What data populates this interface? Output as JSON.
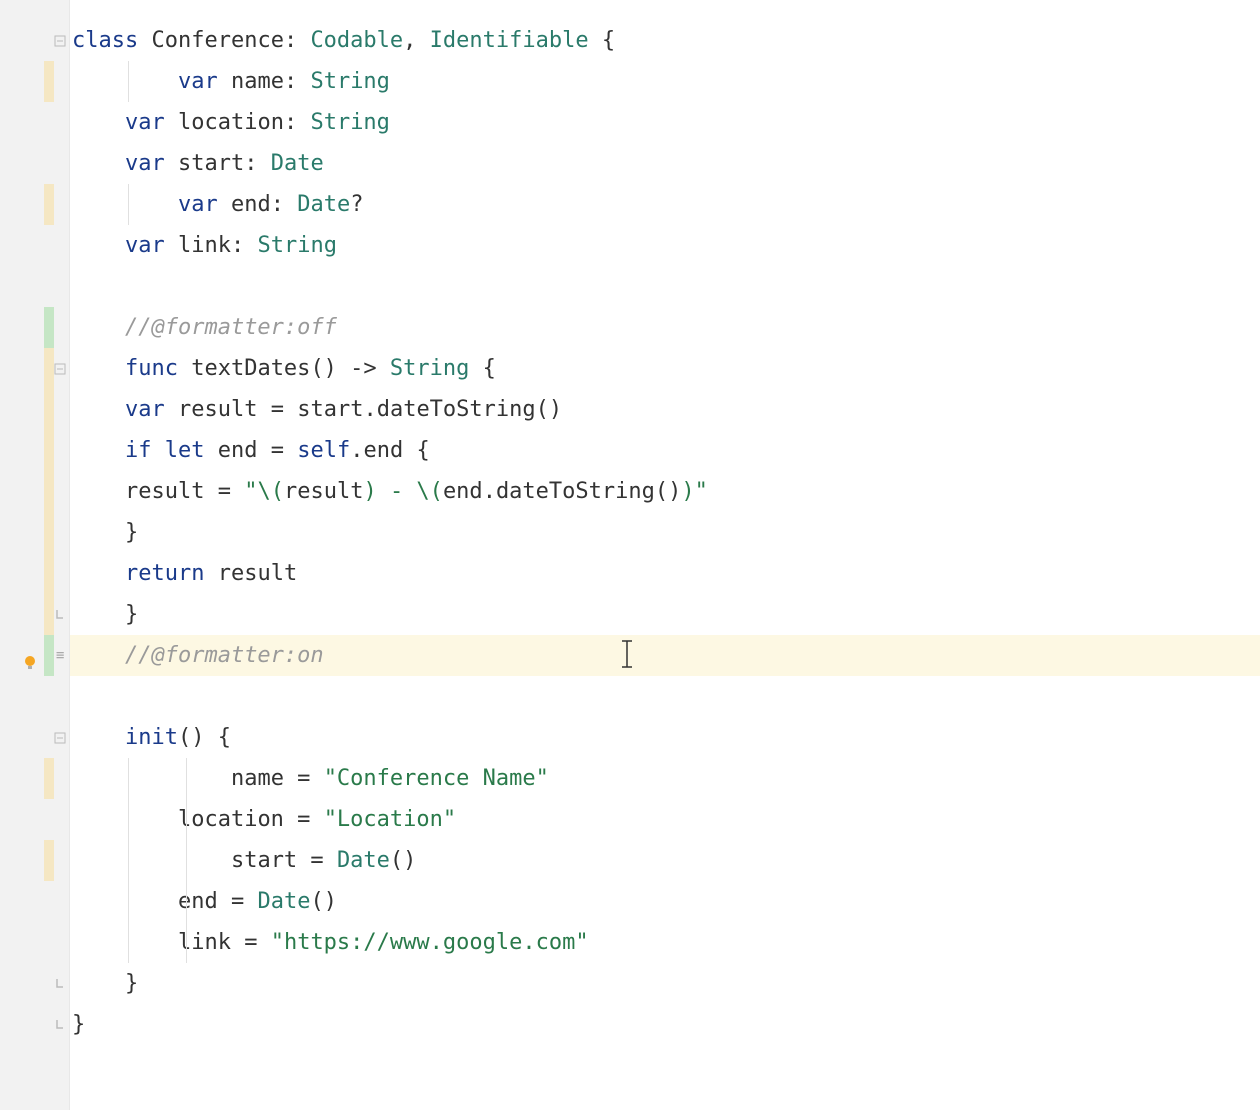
{
  "code": {
    "lines": [
      {
        "indent": 0,
        "tokens": [
          {
            "t": "kw",
            "v": "class"
          },
          {
            "t": "punct",
            "v": " "
          },
          {
            "t": "ident",
            "v": "Conference"
          },
          {
            "t": "punct",
            "v": ": "
          },
          {
            "t": "type",
            "v": "Codable"
          },
          {
            "t": "punct",
            "v": ", "
          },
          {
            "t": "type",
            "v": "Identifiable"
          },
          {
            "t": "punct",
            "v": " {"
          }
        ],
        "fold": "open",
        "marker": null
      },
      {
        "indent": 2,
        "tokens": [
          {
            "t": "kw",
            "v": "var"
          },
          {
            "t": "punct",
            "v": " "
          },
          {
            "t": "ident",
            "v": "name"
          },
          {
            "t": "punct",
            "v": ": "
          },
          {
            "t": "type",
            "v": "String"
          }
        ],
        "marker": "yellow",
        "guide": 1
      },
      {
        "indent": 1,
        "tokens": [
          {
            "t": "kw",
            "v": "var"
          },
          {
            "t": "punct",
            "v": " "
          },
          {
            "t": "ident",
            "v": "location"
          },
          {
            "t": "punct",
            "v": ": "
          },
          {
            "t": "type",
            "v": "String"
          }
        ],
        "marker": null
      },
      {
        "indent": 1,
        "tokens": [
          {
            "t": "kw",
            "v": "var"
          },
          {
            "t": "punct",
            "v": " "
          },
          {
            "t": "ident",
            "v": "start"
          },
          {
            "t": "punct",
            "v": ": "
          },
          {
            "t": "type",
            "v": "Date"
          }
        ],
        "marker": null
      },
      {
        "indent": 2,
        "tokens": [
          {
            "t": "kw",
            "v": "var"
          },
          {
            "t": "punct",
            "v": " "
          },
          {
            "t": "ident",
            "v": "end"
          },
          {
            "t": "punct",
            "v": ": "
          },
          {
            "t": "type",
            "v": "Date"
          },
          {
            "t": "punct",
            "v": "?"
          }
        ],
        "marker": "yellow",
        "guide": 1
      },
      {
        "indent": 1,
        "tokens": [
          {
            "t": "kw",
            "v": "var"
          },
          {
            "t": "punct",
            "v": " "
          },
          {
            "t": "ident",
            "v": "link"
          },
          {
            "t": "punct",
            "v": ": "
          },
          {
            "t": "type",
            "v": "String"
          }
        ],
        "marker": null
      },
      {
        "indent": 0,
        "tokens": [],
        "marker": null
      },
      {
        "indent": 1,
        "tokens": [
          {
            "t": "comment",
            "v": "//@formatter:off"
          }
        ],
        "marker": "green"
      },
      {
        "indent": 1,
        "tokens": [
          {
            "t": "kw",
            "v": "func"
          },
          {
            "t": "punct",
            "v": " "
          },
          {
            "t": "func",
            "v": "textDates"
          },
          {
            "t": "punct",
            "v": "() -> "
          },
          {
            "t": "type",
            "v": "String"
          },
          {
            "t": "punct",
            "v": " {"
          }
        ],
        "fold": "open",
        "marker": "yellow"
      },
      {
        "indent": 1,
        "tokens": [
          {
            "t": "kw",
            "v": "var"
          },
          {
            "t": "punct",
            "v": " "
          },
          {
            "t": "ident",
            "v": "result"
          },
          {
            "t": "punct",
            "v": " = "
          },
          {
            "t": "ident",
            "v": "start"
          },
          {
            "t": "punct",
            "v": "."
          },
          {
            "t": "func",
            "v": "dateToString"
          },
          {
            "t": "punct",
            "v": "()"
          }
        ],
        "marker": "yellow"
      },
      {
        "indent": 1,
        "tokens": [
          {
            "t": "kw",
            "v": "if"
          },
          {
            "t": "punct",
            "v": " "
          },
          {
            "t": "kw",
            "v": "let"
          },
          {
            "t": "punct",
            "v": " "
          },
          {
            "t": "ident",
            "v": "end"
          },
          {
            "t": "punct",
            "v": " = "
          },
          {
            "t": "kw",
            "v": "self"
          },
          {
            "t": "punct",
            "v": "."
          },
          {
            "t": "ident",
            "v": "end"
          },
          {
            "t": "punct",
            "v": " {"
          }
        ],
        "marker": "yellow"
      },
      {
        "indent": 1,
        "tokens": [
          {
            "t": "ident",
            "v": "result"
          },
          {
            "t": "punct",
            "v": " = "
          },
          {
            "t": "str",
            "v": "\"\\("
          },
          {
            "t": "ident",
            "v": "result"
          },
          {
            "t": "str",
            "v": ") - \\("
          },
          {
            "t": "ident",
            "v": "end"
          },
          {
            "t": "punct",
            "v": "."
          },
          {
            "t": "func",
            "v": "dateToString"
          },
          {
            "t": "punct",
            "v": "()"
          },
          {
            "t": "str",
            "v": ")\""
          }
        ],
        "marker": "yellow"
      },
      {
        "indent": 1,
        "tokens": [
          {
            "t": "punct",
            "v": "}"
          }
        ],
        "marker": "yellow"
      },
      {
        "indent": 1,
        "tokens": [
          {
            "t": "kw",
            "v": "return"
          },
          {
            "t": "punct",
            "v": " "
          },
          {
            "t": "ident",
            "v": "result"
          }
        ],
        "marker": "yellow"
      },
      {
        "indent": 1,
        "tokens": [
          {
            "t": "punct",
            "v": "}"
          }
        ],
        "fold": "close",
        "marker": "yellow"
      },
      {
        "indent": 1,
        "tokens": [
          {
            "t": "comment",
            "v": "//@formatter:on"
          }
        ],
        "marker": "green",
        "highlighted": true,
        "bulb": true,
        "cursor": true
      },
      {
        "indent": 0,
        "tokens": [],
        "marker": null
      },
      {
        "indent": 1,
        "tokens": [
          {
            "t": "kw",
            "v": "init"
          },
          {
            "t": "punct",
            "v": "() {"
          }
        ],
        "fold": "open",
        "marker": null
      },
      {
        "indent": 3,
        "tokens": [
          {
            "t": "ident",
            "v": "name"
          },
          {
            "t": "punct",
            "v": " = "
          },
          {
            "t": "str",
            "v": "\"Conference Name\""
          }
        ],
        "marker": "yellow",
        "guide": 2
      },
      {
        "indent": 2,
        "tokens": [
          {
            "t": "ident",
            "v": "location"
          },
          {
            "t": "punct",
            "v": " = "
          },
          {
            "t": "str",
            "v": "\"Location\""
          }
        ],
        "marker": null,
        "guide": 2
      },
      {
        "indent": 3,
        "tokens": [
          {
            "t": "ident",
            "v": "start"
          },
          {
            "t": "punct",
            "v": " = "
          },
          {
            "t": "type",
            "v": "Date"
          },
          {
            "t": "punct",
            "v": "()"
          }
        ],
        "marker": "yellow",
        "guide": 2
      },
      {
        "indent": 2,
        "tokens": [
          {
            "t": "ident",
            "v": "end"
          },
          {
            "t": "punct",
            "v": " = "
          },
          {
            "t": "type",
            "v": "Date"
          },
          {
            "t": "punct",
            "v": "()"
          }
        ],
        "marker": null,
        "guide": 2
      },
      {
        "indent": 2,
        "tokens": [
          {
            "t": "ident",
            "v": "link"
          },
          {
            "t": "punct",
            "v": " = "
          },
          {
            "t": "str",
            "v": "\"https://www.google.com\""
          }
        ],
        "marker": null,
        "guide": 2
      },
      {
        "indent": 1,
        "tokens": [
          {
            "t": "punct",
            "v": "}"
          }
        ],
        "fold": "close",
        "marker": null
      },
      {
        "indent": 0,
        "tokens": [
          {
            "t": "punct",
            "v": "}"
          }
        ],
        "fold": "close",
        "marker": null
      }
    ]
  },
  "colors": {
    "keyword": "#1a3a8a",
    "type": "#2a7a6a",
    "string": "#2a7a4a",
    "comment": "#9a9a9a",
    "yellowMarker": "#f5e7c3",
    "greenMarker": "#c5e6c5",
    "highlightBg": "#fdf8e3"
  }
}
